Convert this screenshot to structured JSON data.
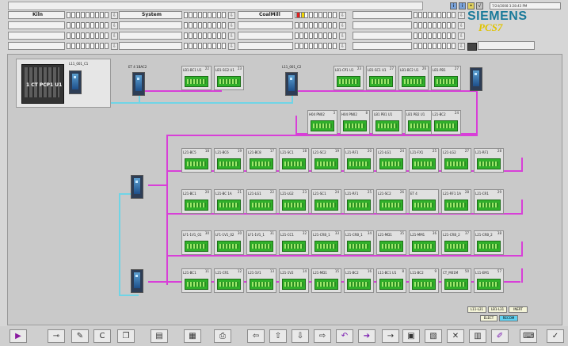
{
  "header": {
    "sections": [
      {
        "label": "Kiln"
      },
      {
        "label": "System"
      },
      {
        "label": "CoalMill"
      }
    ],
    "datetime": "7/24/2008 3:28:43 PM",
    "brand": "SIEMENS",
    "product": "PCS7"
  },
  "plant": {
    "cpu": {
      "label": "L11_001_C1",
      "rack_text": "1 CT PCP1 U1"
    },
    "couplers": [
      {
        "label": "ET 4 1BAC2"
      },
      {
        "label": "L11_001_C2"
      }
    ],
    "modules_row1": [
      {
        "num": "22",
        "label": "LB1-BC1 U1"
      },
      {
        "num": "23",
        "label": "LB1-SG2 U1"
      },
      {
        "num": "23",
        "label": "LB1-CP1 U1"
      },
      {
        "num": "27",
        "label": "LB1-SC1 U1"
      },
      {
        "num": "26",
        "label": "LB1-BC2 U1"
      },
      {
        "num": "27",
        "label": "LB1-PB1"
      }
    ],
    "modules_row1b": [
      {
        "num": "3",
        "label": "H04 PN02"
      },
      {
        "num": "8",
        "label": "H04 PN02"
      },
      {
        "num": "",
        "label": "LB1 PB1 U1"
      },
      {
        "num": "",
        "label": "LB1 PB2 U1"
      },
      {
        "num": "24",
        "label": "L21-BC2"
      }
    ],
    "modules_row2": [
      {
        "num": "18",
        "label": "L21-BC5"
      },
      {
        "num": "19",
        "label": "L21-BC6"
      },
      {
        "num": "17",
        "label": "L21-BC8"
      },
      {
        "num": "18",
        "label": "L21-SC1"
      },
      {
        "num": "19",
        "label": "L21-SC2"
      },
      {
        "num": "20",
        "label": "L21-RF1"
      },
      {
        "num": "24",
        "label": "L21-LG1"
      },
      {
        "num": "25",
        "label": "L21-FX1"
      },
      {
        "num": "27",
        "label": "L21-LG2"
      },
      {
        "num": "28",
        "label": "L21-RF1"
      }
    ],
    "modules_row3": [
      {
        "num": "20",
        "label": "L21-BC1"
      },
      {
        "num": "21",
        "label": "L21-BC 1A"
      },
      {
        "num": "22",
        "label": "L21-LG1"
      },
      {
        "num": "23",
        "label": "L21-LG2"
      },
      {
        "num": "24",
        "label": "L21-SC1"
      },
      {
        "num": "25",
        "label": "L21-RF1"
      },
      {
        "num": "26",
        "label": "L21-SC2"
      },
      {
        "num": "",
        "label": "ET 4"
      },
      {
        "num": "28",
        "label": "L21-RF1 1A"
      },
      {
        "num": "29",
        "label": "L21-CR1"
      }
    ],
    "modules_row4": [
      {
        "num": "30",
        "label": "LF1-1V1_01"
      },
      {
        "num": "30",
        "label": "LF1-1V1_02"
      },
      {
        "num": "31",
        "label": "LF1-1V1_1"
      },
      {
        "num": "32",
        "label": "L21-CC1"
      },
      {
        "num": "33",
        "label": "L21-CRB_1"
      },
      {
        "num": "34",
        "label": "L21-CRB_1"
      },
      {
        "num": "35",
        "label": "L21-MD1"
      },
      {
        "num": "36",
        "label": "L21-MM1"
      },
      {
        "num": "37",
        "label": "L21-CRB_2"
      },
      {
        "num": "38",
        "label": "L21-CRB_2"
      }
    ],
    "modules_row5": [
      {
        "num": "11",
        "label": "L21-BC1"
      },
      {
        "num": "12",
        "label": "L21-CR1"
      },
      {
        "num": "13",
        "label": "L21-1V1"
      },
      {
        "num": "14",
        "label": "L21-1V2"
      },
      {
        "num": "15",
        "label": "L21-MD1"
      },
      {
        "num": "16",
        "label": "L21-BC2"
      },
      {
        "num": "8",
        "label": "L11-BC1 U1"
      },
      {
        "num": "9",
        "label": "L11-BC2"
      },
      {
        "num": "50",
        "label": "CT_M01M"
      },
      {
        "num": "57",
        "label": "L11-EM1"
      }
    ]
  },
  "legend": {
    "items": [
      "L11-L21",
      "LB1-L31",
      "INERT"
    ],
    "items2": [
      "ELECT",
      "RECOM"
    ]
  },
  "toolbar": {
    "icons": [
      "play-icon",
      "key-icon",
      "pen-icon",
      "c-icon",
      "copy-icon",
      "chart-icon",
      "grid-icon",
      "print-icon",
      "left-icon",
      "up-icon",
      "down-icon",
      "right-icon",
      "undo-icon",
      "forward-icon",
      "next-icon",
      "group-icon",
      "page-icon",
      "cross-icon",
      "panel-icon",
      "pencil-icon",
      "keyboard-icon",
      "check-icon"
    ]
  }
}
